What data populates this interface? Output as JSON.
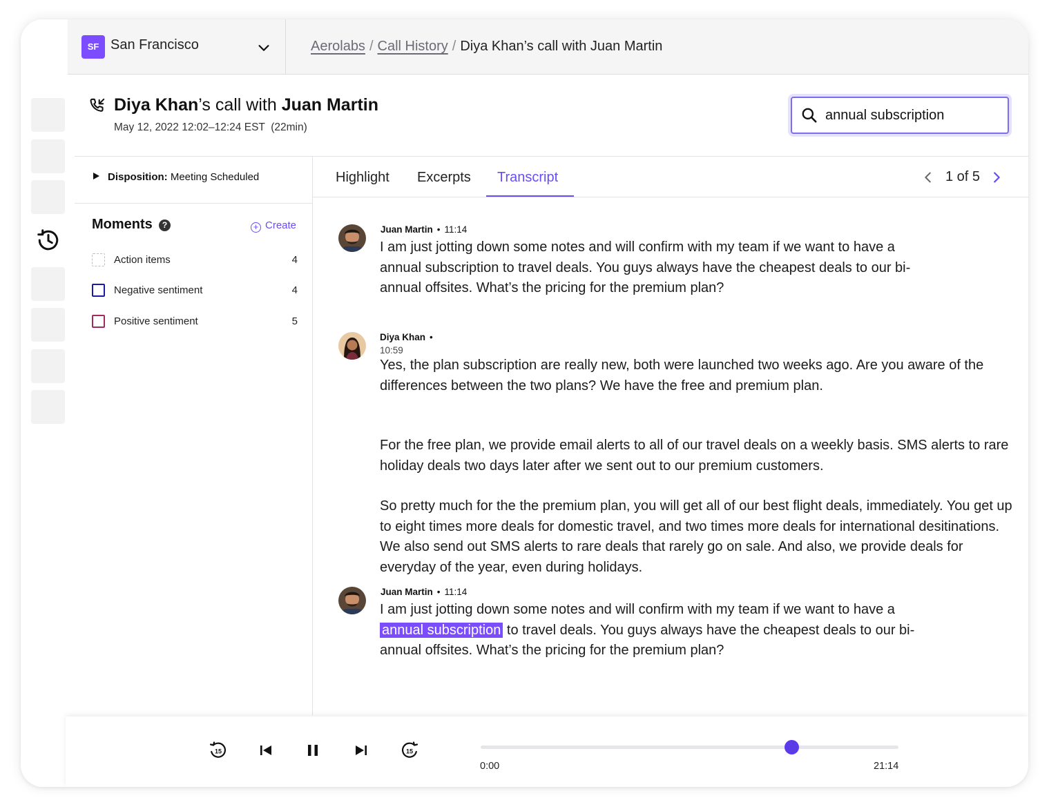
{
  "topbar": {
    "org_initials": "SF",
    "org_name": "San Francisco",
    "breadcrumbs": [
      "Aerolabs",
      "Call History",
      "Diya Khan’s call with Juan Martin"
    ]
  },
  "call": {
    "agent": "Diya Khan",
    "title_mid": "’s call with ",
    "customer": "Juan Martin",
    "meta": "May 12, 2022 12:02–12:24 EST  (22min)"
  },
  "search": {
    "value": "annual subscription"
  },
  "disposition": {
    "label": "Disposition:",
    "value": "Meeting Scheduled"
  },
  "moments": {
    "title": "Moments",
    "help": "?",
    "create_label": "Create",
    "items": [
      {
        "label": "Action items",
        "count": "4",
        "color": "#e7b48a"
      },
      {
        "label": "Negative sentiment",
        "count": "4",
        "color": "#1a1aa8"
      },
      {
        "label": "Positive sentiment",
        "count": "5",
        "color": "#9c2b5e"
      }
    ]
  },
  "tabs": [
    "Highlight",
    "Excerpts",
    "Transcript"
  ],
  "active_tab": "Transcript",
  "pager": {
    "text": "1 of 5"
  },
  "transcript": [
    {
      "speaker": "Juan Martin",
      "time": "11:14",
      "text": "I am just jotting down some notes and will confirm with my team if we want to have a annual subscription to travel deals. You guys always have the cheapest deals to our bi-annual offsites. What’s the pricing for the premium plan?"
    },
    {
      "speaker": "Diya Khan",
      "time": "10:59",
      "paragraphs": [
        "Yes, the plan subscription are really new, both were launched two weeks ago. Are you aware of the differences between the two plans? We have the free and premium plan.",
        "For the free plan, we provide email alerts to all of our travel deals on a weekly basis. SMS alerts to rare holiday deals two days later after we sent out to our premium customers.",
        "So pretty much for the the premium plan, you will get all of our best flight deals, immediately. You get up to eight times more deals for domestic travel, and two times more deals for international desitinations. We also send out SMS alerts to rare deals that rarely go on sale. And also, we provide deals for everyday of the year, even during holidays."
      ]
    },
    {
      "speaker": "Juan Martin",
      "time": "11:14",
      "text_before": "I am just jotting down some notes and will confirm with my team if we want to have a",
      "highlight": "annual subscription",
      "text_after": "to travel deals. You guys always have the cheapest deals to our bi-annual offsites. What’s the pricing for the premium plan?"
    }
  ],
  "player": {
    "time_start": "0:00",
    "time_end": "21:14",
    "progress": 0.745,
    "skip_label": "15"
  },
  "colors": {
    "accent": "#6a4cf2",
    "highlight": "#7c4dff"
  }
}
